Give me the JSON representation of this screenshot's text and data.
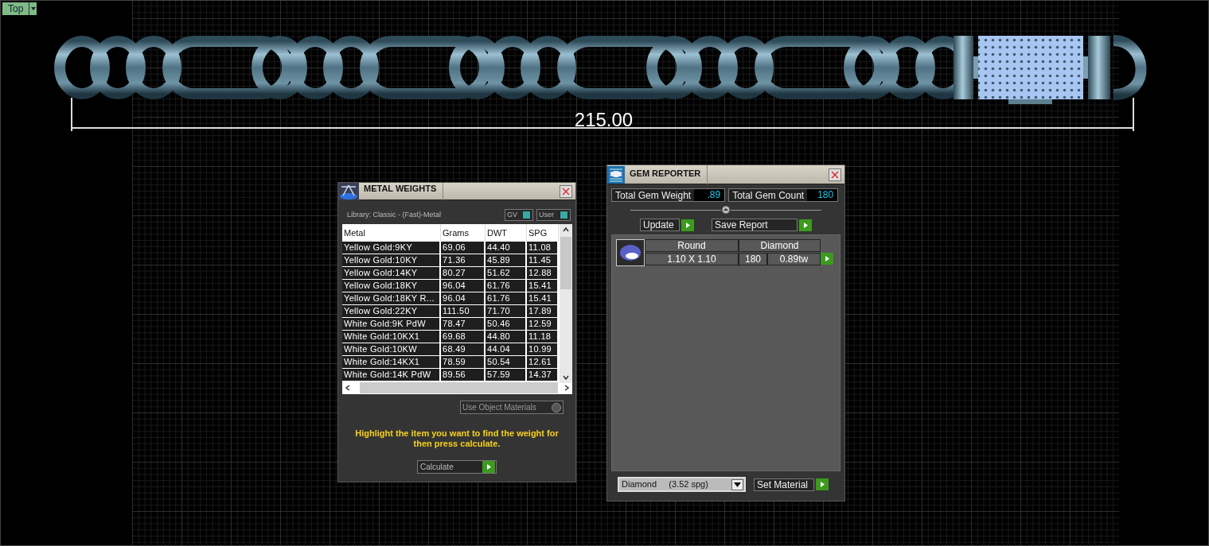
{
  "viewport": {
    "label": "Top"
  },
  "dimension": {
    "value": "215.00"
  },
  "metal_weights": {
    "title": "METAL WEIGHTS",
    "library": "Library: Classic - (Fast)-Metal",
    "toggles": [
      {
        "label": "GV",
        "on": true
      },
      {
        "label": "User",
        "on": true
      }
    ],
    "table": {
      "columns": [
        "Metal",
        "Grams",
        "DWT",
        "SPG"
      ],
      "rows": [
        [
          "Yellow Gold:9KY",
          "69.06",
          "44.40",
          "11.08"
        ],
        [
          "Yellow Gold:10KY",
          "71.36",
          "45.89",
          "11.45"
        ],
        [
          "Yellow Gold:14KY",
          "80.27",
          "51.62",
          "12.88"
        ],
        [
          "Yellow Gold:18KY",
          "96.04",
          "61.76",
          "15.41"
        ],
        [
          "Yellow Gold:18KY R...",
          "96.04",
          "61.76",
          "15.41"
        ],
        [
          "Yellow Gold:22KY",
          "111.50",
          "71.70",
          "17.89"
        ],
        [
          "White Gold:9K PdW",
          "78.47",
          "50.46",
          "12.59"
        ],
        [
          "White Gold:10KX1",
          "69.68",
          "44.80",
          "11.18"
        ],
        [
          "White Gold:10KW",
          "68.49",
          "44.04",
          "10.99"
        ],
        [
          "White Gold:14KX1",
          "78.59",
          "50.54",
          "12.61"
        ],
        [
          "White Gold:14K PdW",
          "89.56",
          "57.59",
          "14.37"
        ]
      ]
    },
    "use_object_materials": {
      "label": "Use Object Materials",
      "checked": false
    },
    "hint": "Highlight the item you want to find the weight for then press calculate.",
    "calculate": "Calculate"
  },
  "gem_reporter": {
    "title": "GEM REPORTER",
    "stats": [
      {
        "label": "Total Gem Weight",
        "value": ".89"
      },
      {
        "label": "Total Gem Count",
        "value": "180"
      }
    ],
    "buttons": [
      "Update",
      "Save Report"
    ],
    "gems": [
      {
        "shape": "Round",
        "size": "1.10 X 1.10",
        "material": "Diamond",
        "count": "180",
        "weight": "0.89tw"
      }
    ],
    "material_select": "Diamond     (3.52 spg)",
    "set_material": "Set Material"
  }
}
